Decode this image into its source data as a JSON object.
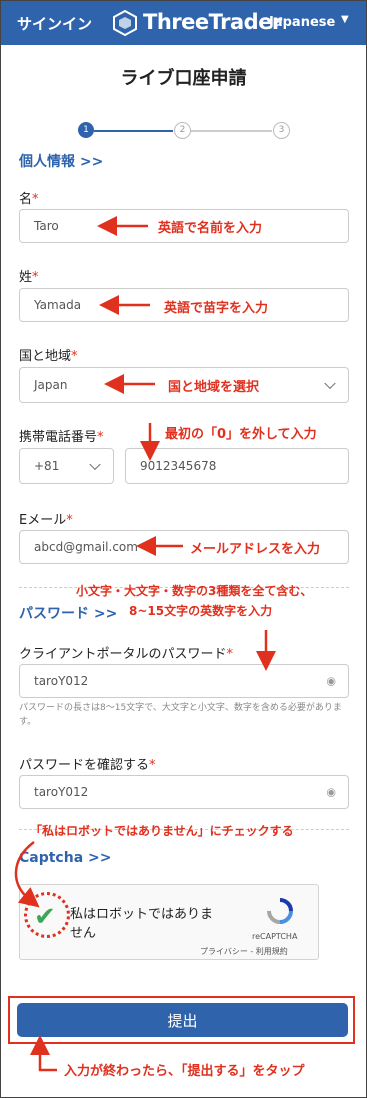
{
  "header": {
    "signin": "サインイン",
    "brand": "ThreeTrader",
    "language": "Japanese"
  },
  "page_title": "ライブ口座申請",
  "steps": [
    "1",
    "2",
    "3"
  ],
  "sections": {
    "personal": "個人情報 >>",
    "password": "パスワード >>",
    "captcha": "Captcha >>"
  },
  "fields": {
    "first_name": {
      "label": "名",
      "value": "Taro"
    },
    "last_name": {
      "label": "姓",
      "value": "Yamada"
    },
    "country": {
      "label": "国と地域",
      "value": "Japan"
    },
    "phone": {
      "label": "携帯電話番号",
      "code": "+81",
      "value": "9012345678"
    },
    "email": {
      "label": "Eメール",
      "value": "abcd@gmail.com"
    },
    "password": {
      "label": "クライアントポータルのパスワード",
      "value": "taroY012",
      "hint": "パスワードの長さは8～15文字で、大文字と小文字、数字を含める必要があります。"
    },
    "confirm": {
      "label": "パスワードを確認する",
      "value": "taroY012"
    }
  },
  "required_mark": "*",
  "captcha": {
    "text": "私はロボットではありません",
    "brand": "reCAPTCHA",
    "links": "プライバシー - 利用規約"
  },
  "submit_label": "提出",
  "annotations": {
    "first_name": "英語で名前を入力",
    "last_name": "英語で苗字を入力",
    "country": "国と地域を選択",
    "phone": "最初の「0」を外して入力",
    "email": "メールアドレスを入力",
    "password_line1": "小文字・大文字・数字の3種類を全て含む、",
    "password_line2": "8~15文字の英数字を入力",
    "captcha": "「私はロボットではありません」にチェックする",
    "submit": "入力が終わったら、「提出する」をタップ"
  },
  "colors": {
    "brand": "#2f64ad",
    "annotation": "#e0301e",
    "check": "#3aa757"
  }
}
